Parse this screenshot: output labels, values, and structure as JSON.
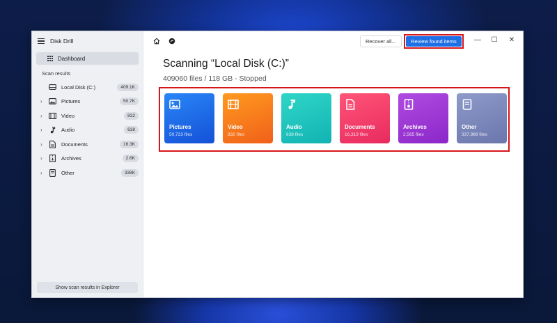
{
  "app": {
    "title": "Disk Drill"
  },
  "sidebar": {
    "dashboard_label": "Dashboard",
    "section_label": "Scan results",
    "items": [
      {
        "label": "Local Disk (C:)",
        "count": "409.1K",
        "icon": "drive-icon",
        "expandable": false
      },
      {
        "label": "Pictures",
        "count": "50.7K",
        "icon": "image-icon",
        "expandable": true
      },
      {
        "label": "Video",
        "count": "832",
        "icon": "film-icon",
        "expandable": true
      },
      {
        "label": "Audio",
        "count": "638",
        "icon": "music-note-icon",
        "expandable": true
      },
      {
        "label": "Documents",
        "count": "16.3K",
        "icon": "document-icon",
        "expandable": true
      },
      {
        "label": "Archives",
        "count": "2.6K",
        "icon": "archive-icon",
        "expandable": true
      },
      {
        "label": "Other",
        "count": "338K",
        "icon": "file-icon",
        "expandable": true
      }
    ],
    "explorer_button": "Show scan results in Explorer"
  },
  "toolbar": {
    "recover_all": "Recover all...",
    "review_found": "Review found items",
    "accent": "#1f6fe5",
    "highlight": "#d6141a"
  },
  "main": {
    "title": "Scanning “Local Disk (C:)”",
    "subtitle": "409060 files / 118 GB - Stopped"
  },
  "cards": [
    {
      "name": "Pictures",
      "files": "50,723 files",
      "icon": "image-icon",
      "colors": [
        "#2a86f7",
        "#1451d8"
      ]
    },
    {
      "name": "Video",
      "files": "832 files",
      "icon": "film-icon",
      "colors": [
        "#ff9a1f",
        "#f0601a"
      ]
    },
    {
      "name": "Audio",
      "files": "638 files",
      "icon": "music-note-icon",
      "colors": [
        "#2fd6c7",
        "#12b3b3"
      ]
    },
    {
      "name": "Documents",
      "files": "16,313 files",
      "icon": "document-icon",
      "colors": [
        "#ff5577",
        "#e82a5f"
      ]
    },
    {
      "name": "Archives",
      "files": "2,565 files",
      "icon": "archive-icon",
      "colors": [
        "#b04be0",
        "#8b27c9"
      ]
    },
    {
      "name": "Other",
      "files": "337,989 files",
      "icon": "file-icon",
      "colors": [
        "#8e9ac9",
        "#6b76ad"
      ]
    }
  ]
}
